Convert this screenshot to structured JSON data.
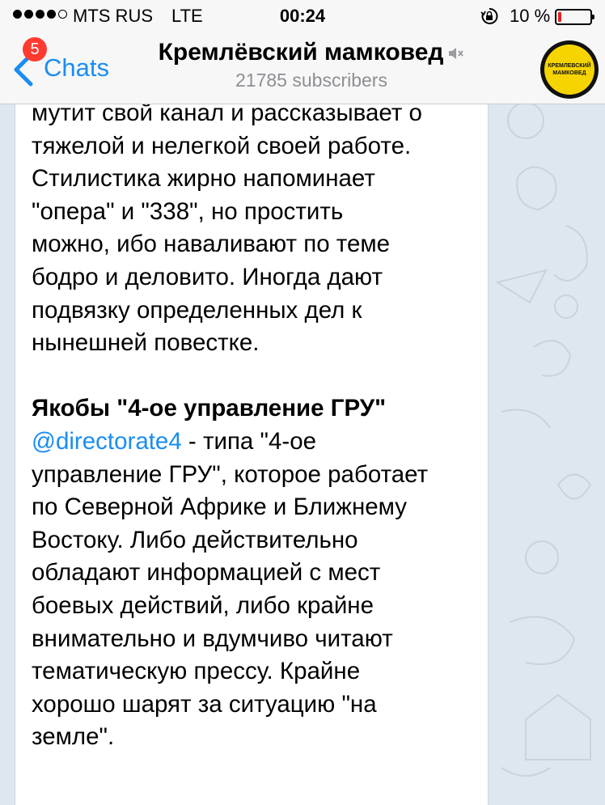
{
  "status_bar": {
    "carrier": "MTS RUS",
    "network": "LTE",
    "time": "00:24",
    "battery_percent": "10 %",
    "battery_level": 0.1
  },
  "nav": {
    "back_label": "Chats",
    "unread_badge": "5",
    "channel_name": "Кремлёвский мамковед",
    "subscribers": "21785 subscribers",
    "avatar_text_line1": "КРЕМЛЕВСКИЙ",
    "avatar_text_line2": "МАМКОВЕД"
  },
  "colors": {
    "accent": "#1a8df0",
    "badge": "#ff3b30",
    "avatar_bg": "#f6d400"
  },
  "message": {
    "para1_lines": [
      "мутит свой канал и рассказывает о",
      "тяжелой и нелегкой своей работе.",
      "Стилистика жирно напоминает",
      "\"опера\" и \"338\", но простить",
      "можно, ибо наваливают по теме",
      "бодро и деловито. Иногда дают",
      "подвязку определенных дел к",
      "нынешней повестке."
    ],
    "heading": "Якобы \"4-ое управление ГРУ\"",
    "mention": "@directorate4",
    "mention_tail": " - типа \"4-ое",
    "para2_lines": [
      "управление ГРУ\", которое работает",
      "по Северной Африке и Ближнему",
      "Востоку. Либо действительно",
      "обладают информацией с мест",
      "боевых действий, либо крайне",
      "внимательно и вдумчиво читают",
      "тематическую прессу. Крайне",
      "хорошо шарят за ситуацию \"на",
      "земле\"."
    ]
  }
}
